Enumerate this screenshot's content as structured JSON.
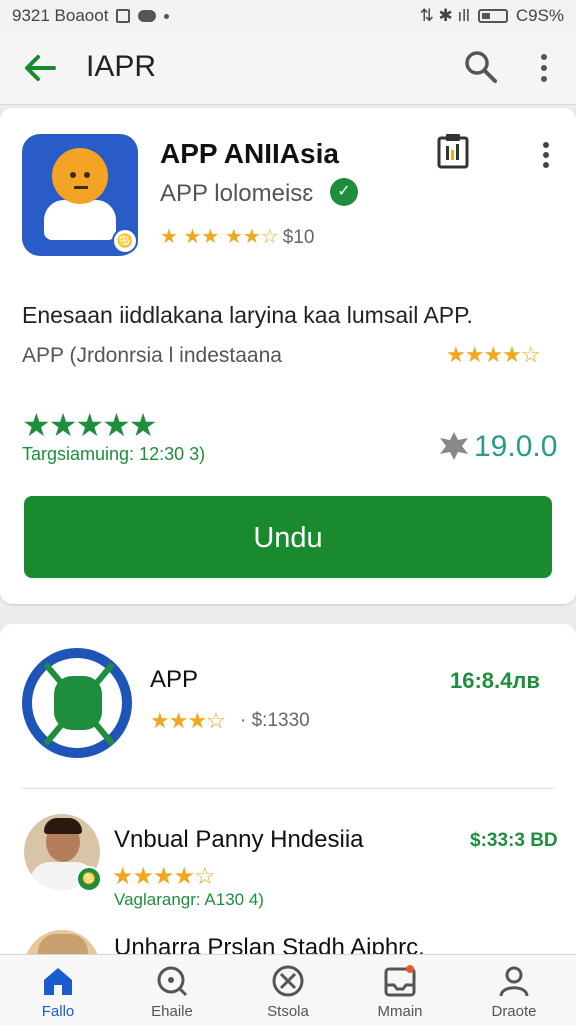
{
  "status_bar": {
    "time": "9321 Boaoot",
    "battery": "C9S%"
  },
  "app_bar": {
    "title": "IAPR"
  },
  "featured": {
    "title": "APP ANIIAsia",
    "developer": "APP lolomeisɛ",
    "rating_text": "$10",
    "description": "Enesaan iiddlakana  laryina kaa lumsail APP.",
    "subtitle": "APP (Jrdonrsia l indestaana",
    "sub_stars": "★★★★☆",
    "big_stars": "★★★★★",
    "rating_line": "Targsiamuing: 12:30 3)",
    "price": "19.0.0",
    "install_label": "Undu",
    "head_stars": "★ ★★ ★★☆"
  },
  "list": [
    {
      "title": "APP",
      "price": "16:8.4лв",
      "stars": "★★★☆",
      "meta": "· $:1330"
    },
    {
      "title": "Vnbual Panny Hndesiia",
      "price": "$:33:3 BD",
      "stars": "★★★★☆",
      "sub": "Vaglarangr: A130 4)"
    },
    {
      "title": "Unharra Prslan Stadh Aiphrc."
    }
  ],
  "bottom_nav": [
    {
      "label": "Fallo"
    },
    {
      "label": "Ehaile"
    },
    {
      "label": "Stsola"
    },
    {
      "label": "Mmain"
    },
    {
      "label": "Draote"
    }
  ],
  "colors": {
    "accent_green": "#1a8a2e",
    "nav_active": "#1a5ccf",
    "star": "#f0a820",
    "price_teal": "#2a9a8a"
  }
}
